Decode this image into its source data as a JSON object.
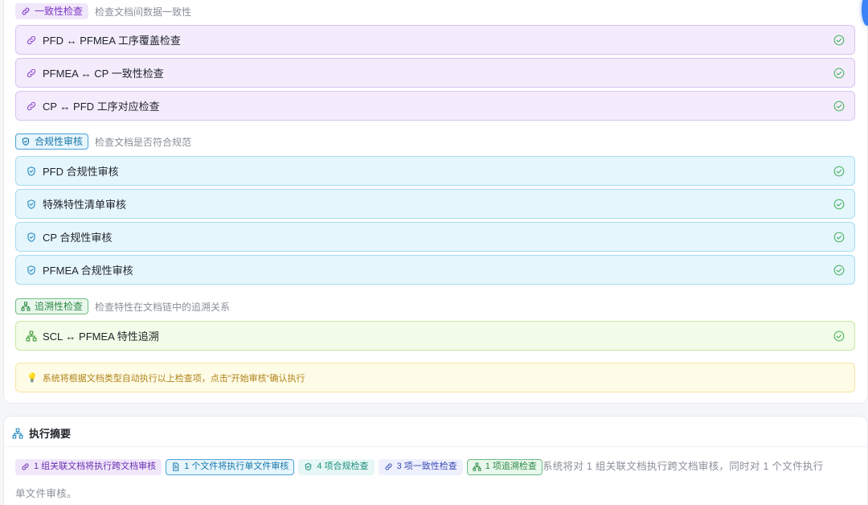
{
  "consistency": {
    "tag": "一致性检查",
    "desc": "检查文档间数据一致性",
    "items": [
      {
        "label": "PFD ↔ PFMEA 工序覆盖检查"
      },
      {
        "label": "PFMEA ↔ CP 一致性检查"
      },
      {
        "label": "CP ↔ PFD 工序对应检查"
      }
    ]
  },
  "compliance": {
    "tag": "合规性审核",
    "desc": "检查文档是否符合规范",
    "items": [
      {
        "label": "PFD 合规性审核"
      },
      {
        "label": "特殊特性清单审核"
      },
      {
        "label": "CP 合规性审核"
      },
      {
        "label": "PFMEA 合规性审核"
      }
    ]
  },
  "traceability": {
    "tag": "追溯性检查",
    "desc": "检查特性在文档链中的追溯关系",
    "items": [
      {
        "label": "SCL ↔ PFMEA 特性追溯"
      }
    ]
  },
  "tip": {
    "icon": "lightbulb-icon",
    "text": "系统将根据文档类型自动执行以上检查项，点击\"开始审核\"确认执行"
  },
  "summary": {
    "title": "执行摘要",
    "chips": [
      {
        "text": "1 组关联文档将执行跨文档审核",
        "icon": "link-icon"
      },
      {
        "text": "1 个文件将执行单文件审核",
        "icon": "document-icon"
      },
      {
        "text": "4 项合规检查",
        "icon": "shield-icon"
      },
      {
        "text": "3 项一致性检查",
        "icon": "link-icon"
      },
      {
        "text": "1 项追溯检查",
        "icon": "hierarchy-icon"
      }
    ],
    "text_line1": "系统将对 1 组关联文档执行跨文档审核，同时对 1 个文件执行",
    "text_line2": "单文件审核。"
  },
  "colors": {
    "purple": "#7b36c4",
    "blue": "#1677a8",
    "green": "#2e8b47",
    "check": "#52b86a"
  }
}
